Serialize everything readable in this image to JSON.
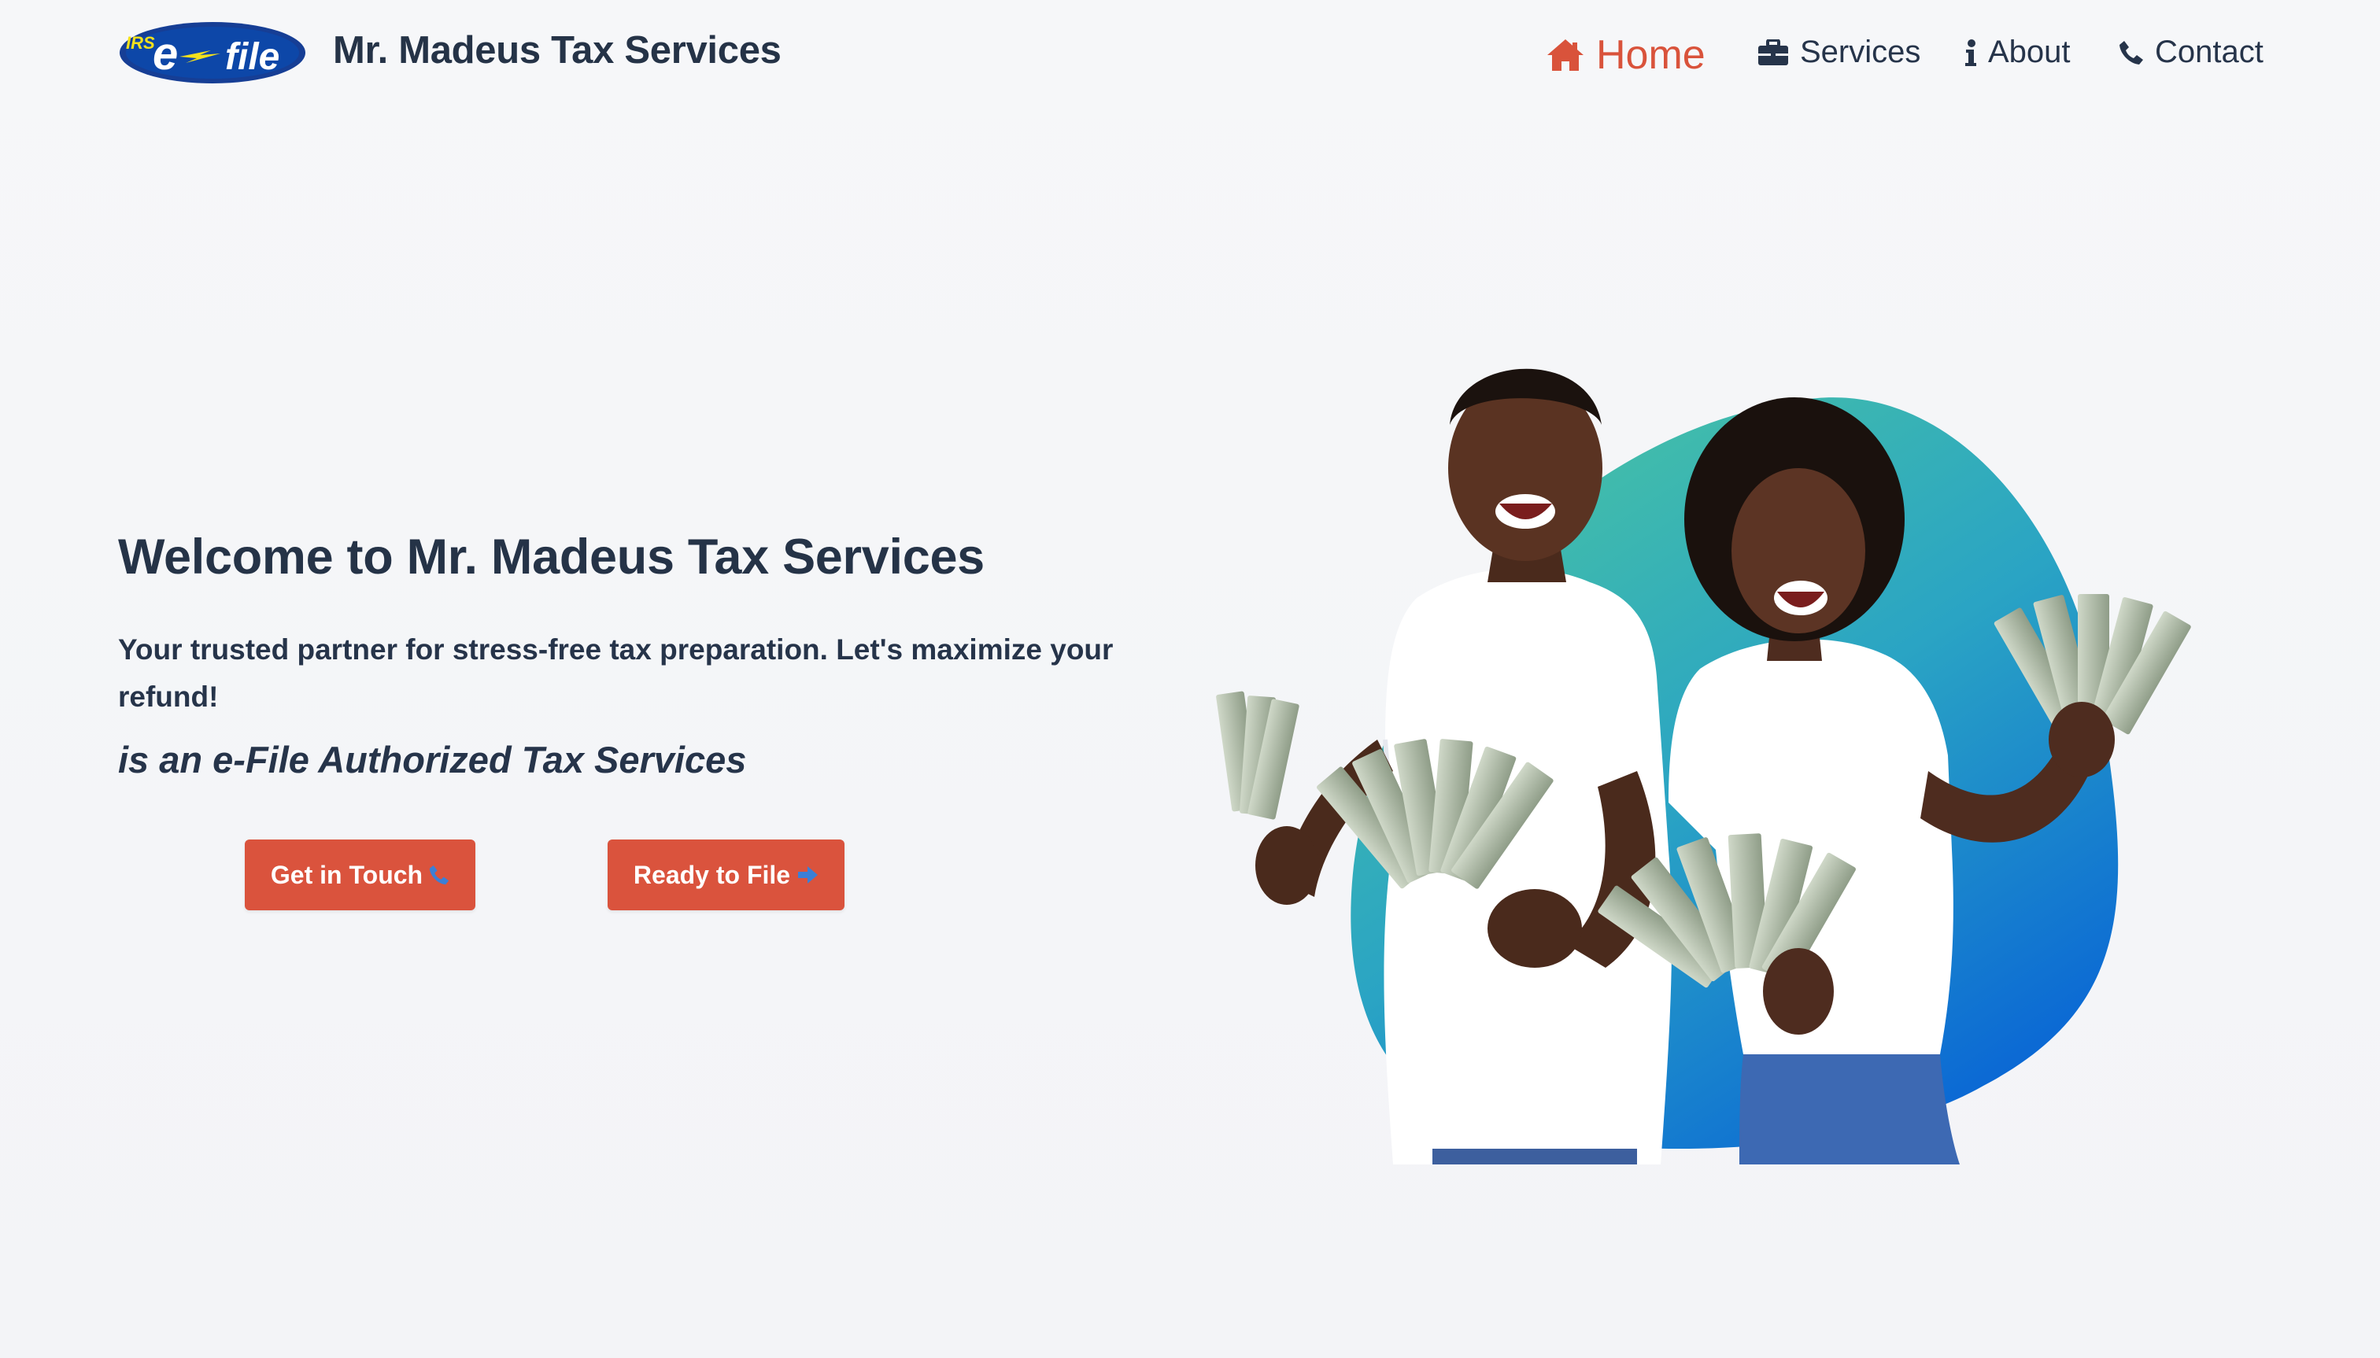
{
  "header": {
    "logo_icon": "irs-e-file-logo",
    "logo_text": {
      "irs": "IRS",
      "e": "e",
      "file": "file"
    },
    "brand": "Mr. Madeus Tax Services"
  },
  "nav": {
    "active_color": "#d9533b",
    "items": [
      {
        "label": "Home",
        "icon": "home-icon",
        "active": true
      },
      {
        "label": "Services",
        "icon": "briefcase-icon",
        "active": false
      },
      {
        "label": "About",
        "icon": "info-icon",
        "active": false
      },
      {
        "label": "Contact",
        "icon": "phone-icon",
        "active": false
      }
    ]
  },
  "hero": {
    "title": "Welcome to Mr. Madeus Tax Services",
    "subtitle": "Your trusted partner for stress-free tax preparation. Let's maximize your refund!",
    "tagline": "is an e-File Authorized Tax Services",
    "buttons": {
      "touch": {
        "label": "Get in Touch",
        "icon": "phone-icon"
      },
      "file": {
        "label": "Ready to File",
        "icon": "arrow-right-icon"
      }
    },
    "image": {
      "description_icon": "happy-couple-holding-cash-illustration",
      "blob_colors": [
        "#3fb9a8",
        "#0f6fd6"
      ]
    }
  },
  "colors": {
    "accent": "#da533d",
    "text": "#253347",
    "background": "#f4f5f8"
  }
}
